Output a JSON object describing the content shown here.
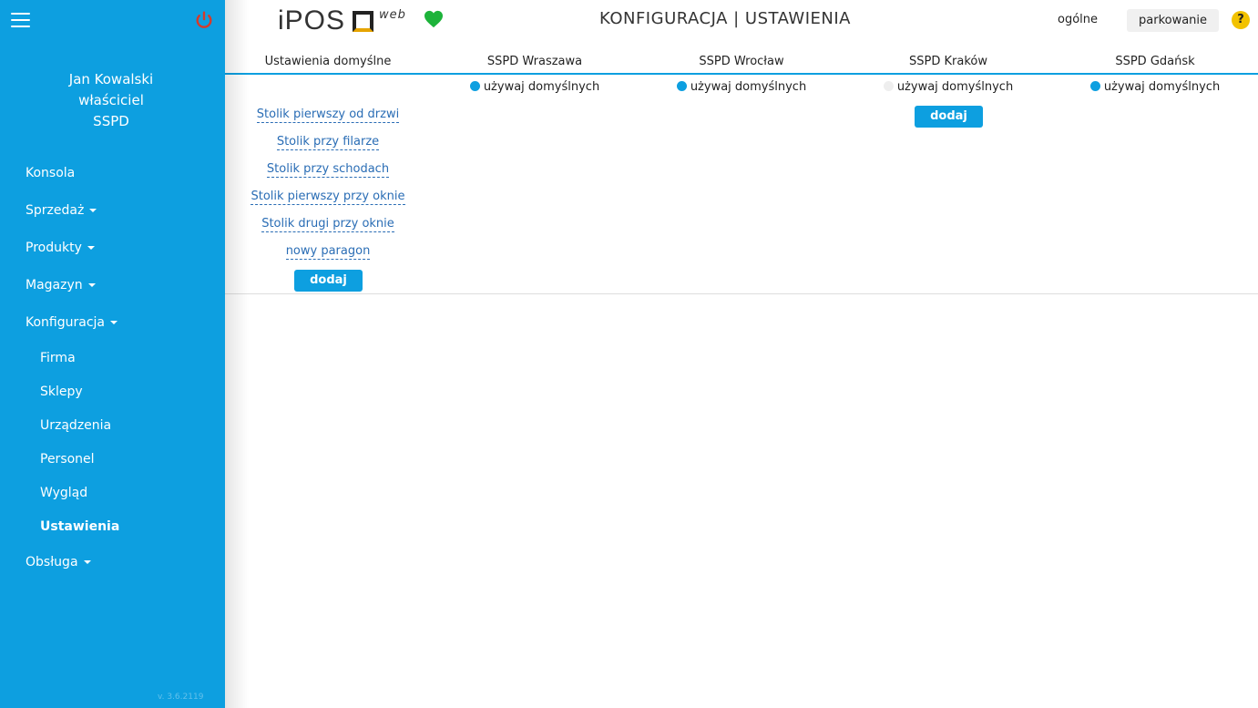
{
  "sidebar": {
    "user": {
      "name": "Jan Kowalski",
      "role": "właściciel",
      "company": "SSPD"
    },
    "items": [
      {
        "label": "Konsola"
      },
      {
        "label": "Sprzedaż"
      },
      {
        "label": "Produkty"
      },
      {
        "label": "Magazyn"
      },
      {
        "label": "Konfiguracja"
      },
      {
        "label": "Obsługa"
      }
    ],
    "subitems": [
      {
        "label": "Firma"
      },
      {
        "label": "Sklepy"
      },
      {
        "label": "Urządzenia"
      },
      {
        "label": "Personel"
      },
      {
        "label": "Wygląd"
      },
      {
        "label": "Ustawienia"
      }
    ],
    "version": "v. 3.6.2119",
    "color": "#0d9fe0"
  },
  "header": {
    "logo_text": "iPOS",
    "logo_suffix": "web",
    "title": "KONFIGURACJA | USTAWIENIA",
    "tab_general": "ogólne",
    "tab_parking": "parkowanie",
    "help": "?"
  },
  "columns": [
    {
      "label": "Ustawienia domyślne"
    },
    {
      "label": "SSPD Wraszawa",
      "radio": "używaj domyślnych",
      "selected": true
    },
    {
      "label": "SSPD Wrocław",
      "radio": "używaj domyślnych",
      "selected": true
    },
    {
      "label": "SSPD Kraków",
      "radio": "używaj domyślnych",
      "selected": false
    },
    {
      "label": "SSPD Gdańsk",
      "radio": "używaj domyślnych",
      "selected": true
    }
  ],
  "default_items": [
    "Stolik pierwszy od drzwi",
    "Stolik przy filarze",
    "Stolik przy schodach",
    "Stolik pierwszy przy oknie",
    "Stolik drugi przy oknie",
    "nowy paragon"
  ],
  "add_label": "dodaj"
}
